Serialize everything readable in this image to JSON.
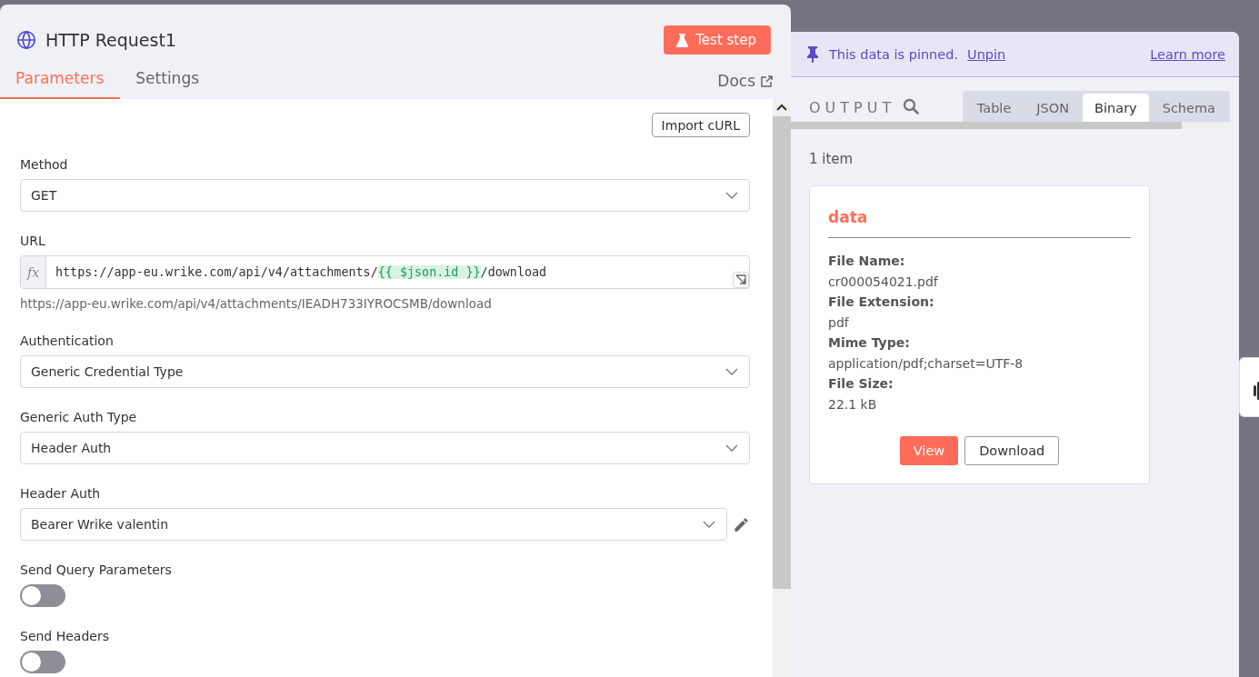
{
  "node": {
    "title": "HTTP Request1",
    "test_button": "Test step",
    "tabs": [
      {
        "label": "Parameters",
        "selected": true
      },
      {
        "label": "Settings",
        "selected": false
      }
    ],
    "docs_link": "Docs",
    "import_button": "Import cURL",
    "fields": [
      {
        "kind": "select",
        "label": "Method",
        "value": "GET"
      },
      {
        "kind": "expression",
        "label": "URL",
        "segments": [
          {
            "kind": "text",
            "text": "https://app-eu.wrike.com/api/v4/attachments/"
          },
          {
            "kind": "expression",
            "text": "{{ $json.id }}"
          },
          {
            "kind": "text",
            "text": "/download"
          }
        ],
        "fx": "fx",
        "preview": "https://app-eu.wrike.com/api/v4/attachments/IEADH733IYROCSMB/download"
      },
      {
        "kind": "select",
        "label": "Authentication",
        "value": "Generic Credential Type"
      },
      {
        "kind": "select",
        "label": "Generic Auth Type",
        "value": "Header Auth"
      },
      {
        "kind": "credential",
        "label": "Header Auth",
        "value": "Bearer Wrike valentin"
      },
      {
        "kind": "toggle",
        "label": "Send Query Parameters",
        "on": false
      },
      {
        "kind": "toggle",
        "label": "Send Headers",
        "on": false
      }
    ]
  },
  "output": {
    "banner": {
      "text": "This data is pinned.",
      "unpin": "Unpin",
      "learn_more": "Learn more"
    },
    "label": "OUTPUT",
    "tabs": [
      {
        "label": "Table",
        "selected": false
      },
      {
        "label": "JSON",
        "selected": false
      },
      {
        "label": "Binary",
        "selected": true
      },
      {
        "label": "Schema",
        "selected": false
      }
    ],
    "count": "1 item",
    "card": {
      "title": "data",
      "properties": [
        {
          "label": "File Name:",
          "value": "cr000054021.pdf"
        },
        {
          "label": "File Extension:",
          "value": "pdf"
        },
        {
          "label": "Mime Type:",
          "value": "application/pdf;charset=UTF-8"
        },
        {
          "label": "File Size:",
          "value": "22.1 kB"
        }
      ],
      "view_button": "View",
      "download_button": "Download"
    }
  }
}
